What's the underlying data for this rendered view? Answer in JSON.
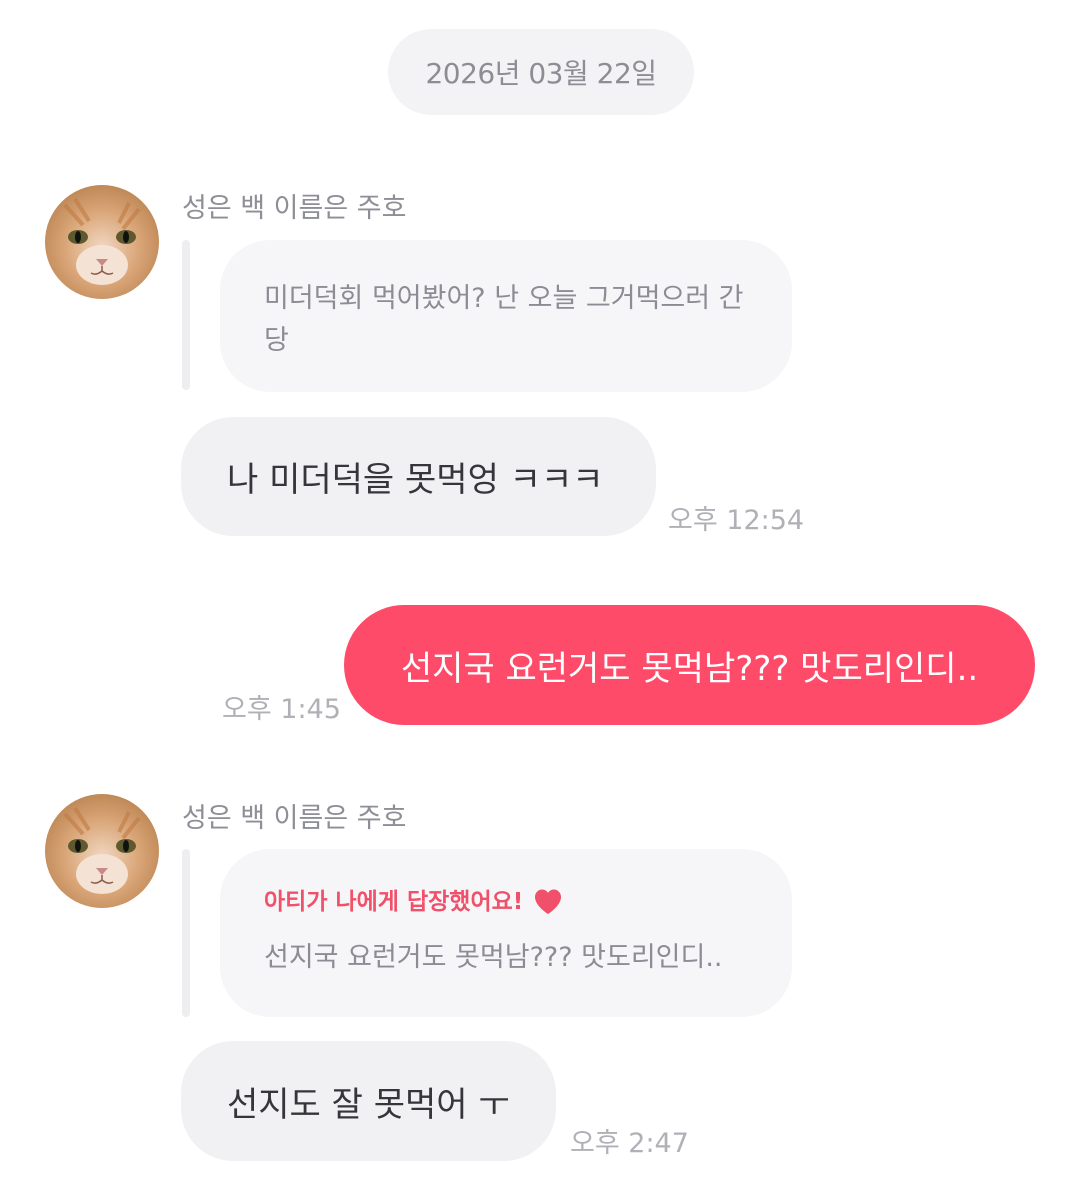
{
  "date_divider": "2026년 03월 22일",
  "messages": [
    {
      "sender": "성은 백 이름은 주호",
      "avatar_icon": "cat-avatar-icon",
      "reply_preview": "미더덕회 먹어봤어? 난 오늘 그거먹으러 간당",
      "text": "나 미더덕을 못먹엉 ㅋㅋㅋ",
      "time": "오후 12:54"
    },
    {
      "outgoing": true,
      "text": "선지국 요런거도 못먹남??? 맛도리인디..",
      "time": "오후 1:45",
      "bubble_color": "#ff4b6a"
    },
    {
      "sender": "성은 백 이름은 주호",
      "avatar_icon": "cat-avatar-icon",
      "reply_header": "아티가 나에게 답장했어요!",
      "reply_header_icon": "heart-icon",
      "reply_preview": "선지국 요런거도 못먹남??? 맛도리인디..",
      "text": "선지도 잘 못먹어 ㅜ",
      "time": "오후 2:47"
    }
  ],
  "colors": {
    "accent": "#ff4b6a",
    "reply_header": "#f0506a",
    "incoming_bubble": "#f1f1f3",
    "reply_bubble": "#f6f6f8"
  }
}
